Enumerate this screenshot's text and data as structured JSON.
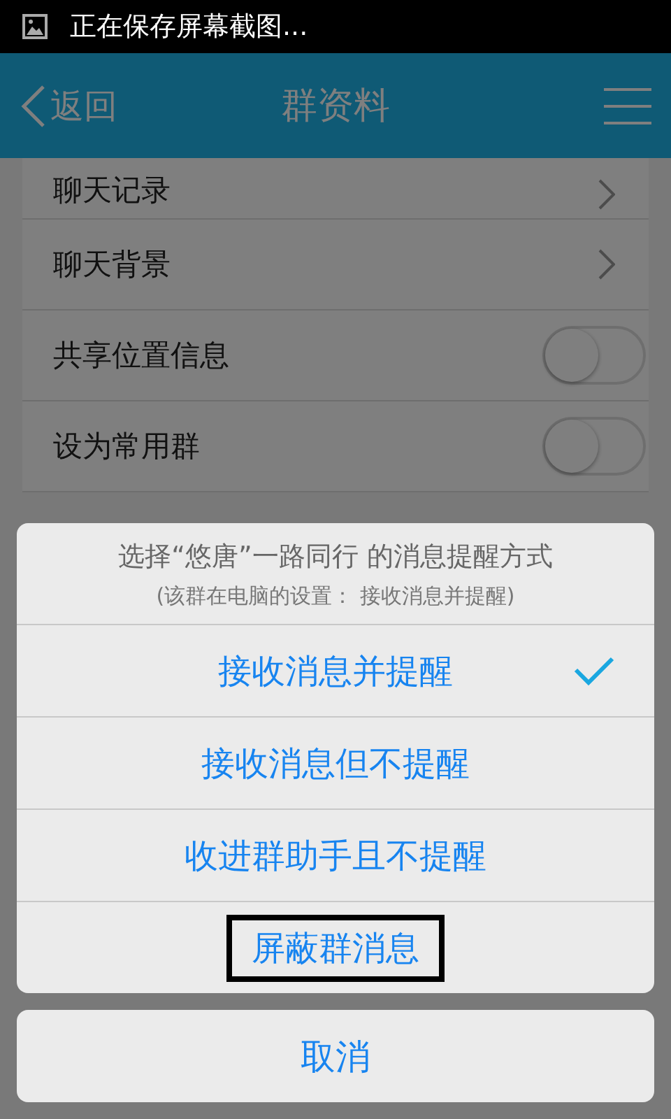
{
  "status_bar": {
    "text": "正在保存屏幕截图..."
  },
  "nav": {
    "back": "返回",
    "title": "群资料"
  },
  "rows": [
    {
      "label": "聊天记录",
      "kind": "link"
    },
    {
      "label": "聊天背景",
      "kind": "link"
    },
    {
      "label": "共享位置信息",
      "kind": "toggle",
      "on": false
    },
    {
      "label": "设为常用群",
      "kind": "toggle",
      "on": false
    }
  ],
  "dialog": {
    "title": "选择“悠唐”一路同行 的消息提醒方式",
    "subtitle": "(该群在电脑的设置： 接收消息并提醒)",
    "options": [
      {
        "label": "接收消息并提醒",
        "selected": true,
        "boxed": false
      },
      {
        "label": "接收消息但不提醒",
        "selected": false,
        "boxed": false
      },
      {
        "label": "收进群助手且不提醒",
        "selected": false,
        "boxed": false
      },
      {
        "label": "屏蔽群消息",
        "selected": false,
        "boxed": true
      }
    ],
    "cancel": "取消"
  }
}
